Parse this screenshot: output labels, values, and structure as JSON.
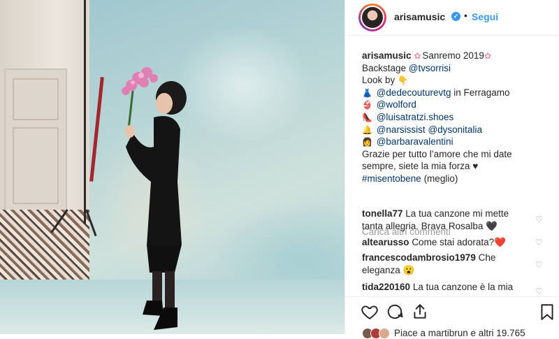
{
  "post": {
    "username": "arisamusic",
    "dot": "•",
    "follow_label": "Segui",
    "verified_icon": "✓"
  },
  "caption": {
    "username": "arisamusic",
    "line1_text": "Sanremo 2019",
    "line2_text": "Backstage ",
    "line2_mention": "@tvsorrisi",
    "line3_text": "Look by",
    "credits": [
      {
        "emoji": "👗",
        "mention": "@dedecouturevtg",
        "suffix": " in Ferragamo"
      },
      {
        "emoji": "👙",
        "mention": "@wolford",
        "suffix": ""
      },
      {
        "emoji": "👠",
        "mention": "@luisatratzi.shoes",
        "suffix": ""
      },
      {
        "emoji": "🔔",
        "mention": "@narsissist",
        "suffix": " ",
        "mention2": "@dysonitalia"
      },
      {
        "emoji": "👩",
        "mention": "@barbaravalentini",
        "suffix": ""
      }
    ],
    "thanks_line1": "Grazie per tutto l’amore che mi date",
    "thanks_line2": "sempre, siete la mia forza ♥",
    "hashtag": "#misentobene",
    "hashtag_suffix": " (meglio)"
  },
  "load_more": "Carica altri commenti",
  "comments": [
    {
      "user": "tonella77",
      "text": "La tua canzone mi mette tanta allegria. Brava Rosalba 🖤"
    },
    {
      "user": "altearusso",
      "text": "Come stai adorata?❤️"
    },
    {
      "user": "francescodambrosio1979",
      "text": "Che eleganza 😮"
    },
    {
      "user": "tida220160",
      "text": "La tua canzone è la mia"
    }
  ],
  "likes_text": "Piace a martibrun e altri 19.765",
  "icons": {
    "like": "heart-icon",
    "comment": "comment-icon",
    "share": "share-icon",
    "save": "bookmark-icon",
    "comment_like": "heart-outline-icon"
  },
  "colors": {
    "link": "#003569",
    "follow": "#3897f0",
    "muted": "#999999"
  }
}
